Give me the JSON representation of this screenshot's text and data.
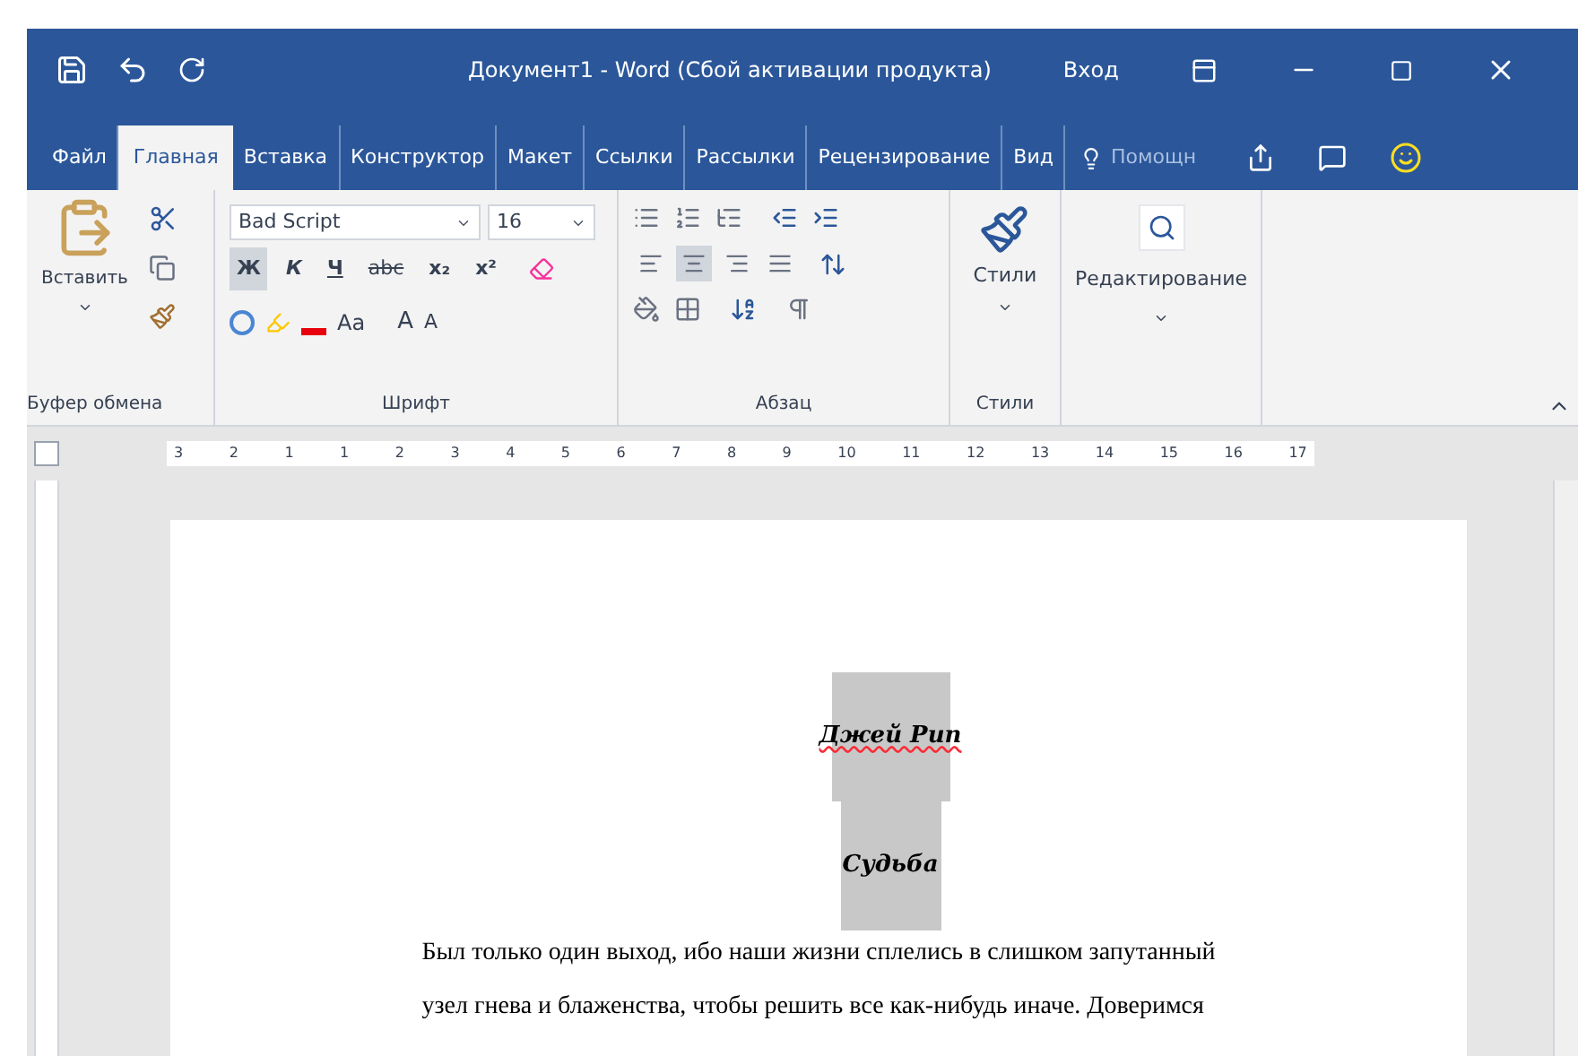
{
  "title_bar": {
    "title": "Документ1  -  Word (Сбой активации продукта)",
    "sign_in": "Вход"
  },
  "tabs": [
    {
      "label": "Файл",
      "selected": false
    },
    {
      "label": "Главная",
      "selected": true
    },
    {
      "label": "Вставка",
      "selected": false
    },
    {
      "label": "Конструктор",
      "selected": false
    },
    {
      "label": "Макет",
      "selected": false
    },
    {
      "label": "Ссылки",
      "selected": false
    },
    {
      "label": "Рассылки",
      "selected": false
    },
    {
      "label": "Рецензирование",
      "selected": false
    },
    {
      "label": "Вид",
      "selected": false
    }
  ],
  "tell_me": {
    "placeholder": "Помощн"
  },
  "clipboard": {
    "paste": "Вставить",
    "label": "Буфер обмена"
  },
  "font": {
    "name": "Bad Script",
    "size": "16",
    "label": "Шрифт",
    "format_buttons": [
      {
        "label": "Ж",
        "kind": "bold",
        "selected": true
      },
      {
        "label": "К",
        "kind": "italic",
        "selected": false
      },
      {
        "label": "Ч",
        "kind": "underline",
        "selected": false
      },
      {
        "label": "abc",
        "kind": "strike",
        "selected": false
      },
      {
        "label": "x₂",
        "kind": "plain",
        "selected": false
      },
      {
        "label": "x²",
        "kind": "plain",
        "selected": false
      }
    ],
    "case_button": "Aa",
    "grow_button": "A",
    "shrink_button": "A"
  },
  "paragraph": {
    "label": "Абзац",
    "alignment": [
      {
        "kind": "left",
        "selected": false
      },
      {
        "kind": "center",
        "selected": true
      },
      {
        "kind": "right",
        "selected": false
      },
      {
        "kind": "justify",
        "selected": false
      }
    ]
  },
  "styles": {
    "button": "Стили",
    "label": "Стили"
  },
  "editing": {
    "button": "Редактирование"
  },
  "ruler": {
    "labels": [
      "3",
      "2",
      "1",
      "1",
      "2",
      "3",
      "4",
      "5",
      "6",
      "7",
      "8",
      "9",
      "10",
      "11",
      "12",
      "13",
      "14",
      "15",
      "16",
      "17"
    ]
  },
  "document": {
    "title": "Джей Рип",
    "subtitle": "Судьба",
    "lines": [
      "Был только один выход, ибо наши жизни сплелись в слишком запутанный",
      "узел гнева и блаженства, чтобы решить все как-нибудь иначе. Доверимся"
    ]
  }
}
